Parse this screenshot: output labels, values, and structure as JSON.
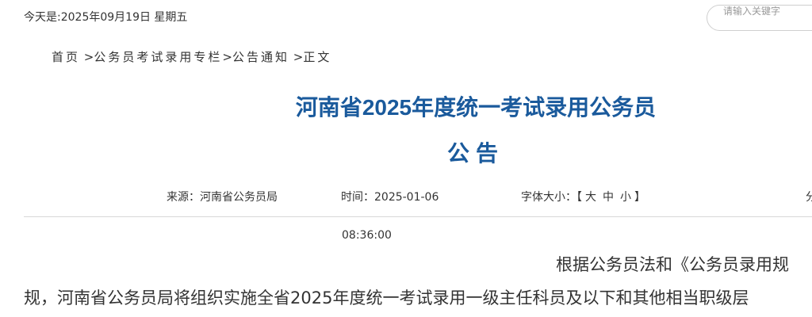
{
  "header": {
    "date_text": "今天是:2025年09月19日 星期五",
    "search": {
      "placeholder": "请输入关键字"
    }
  },
  "breadcrumb": {
    "items": [
      "首页",
      "公务员考试录用专栏",
      "公告通知",
      "正文"
    ],
    "separators": [
      " >",
      ">",
      " >"
    ]
  },
  "article": {
    "title_line1": "河南省2025年度统一考试录用公务员",
    "title_line2": "公告",
    "meta": {
      "source": "来源：河南省公务员局",
      "time_label": "时间：",
      "time_date": "2025-01-06",
      "time_clock": "08:36:00",
      "font_size_label": "字体大小：",
      "font_size_open": "【",
      "font_size_options": [
        "大",
        "中",
        "小"
      ],
      "font_size_close": "】",
      "share_partial": "分"
    },
    "body": {
      "line1": "根据公务员法和《公务员录用规",
      "line2": "规，河南省公务员局将组织实施全省2025年度统一考试录用一级主任科员及以下和其他相当职级层"
    }
  }
}
